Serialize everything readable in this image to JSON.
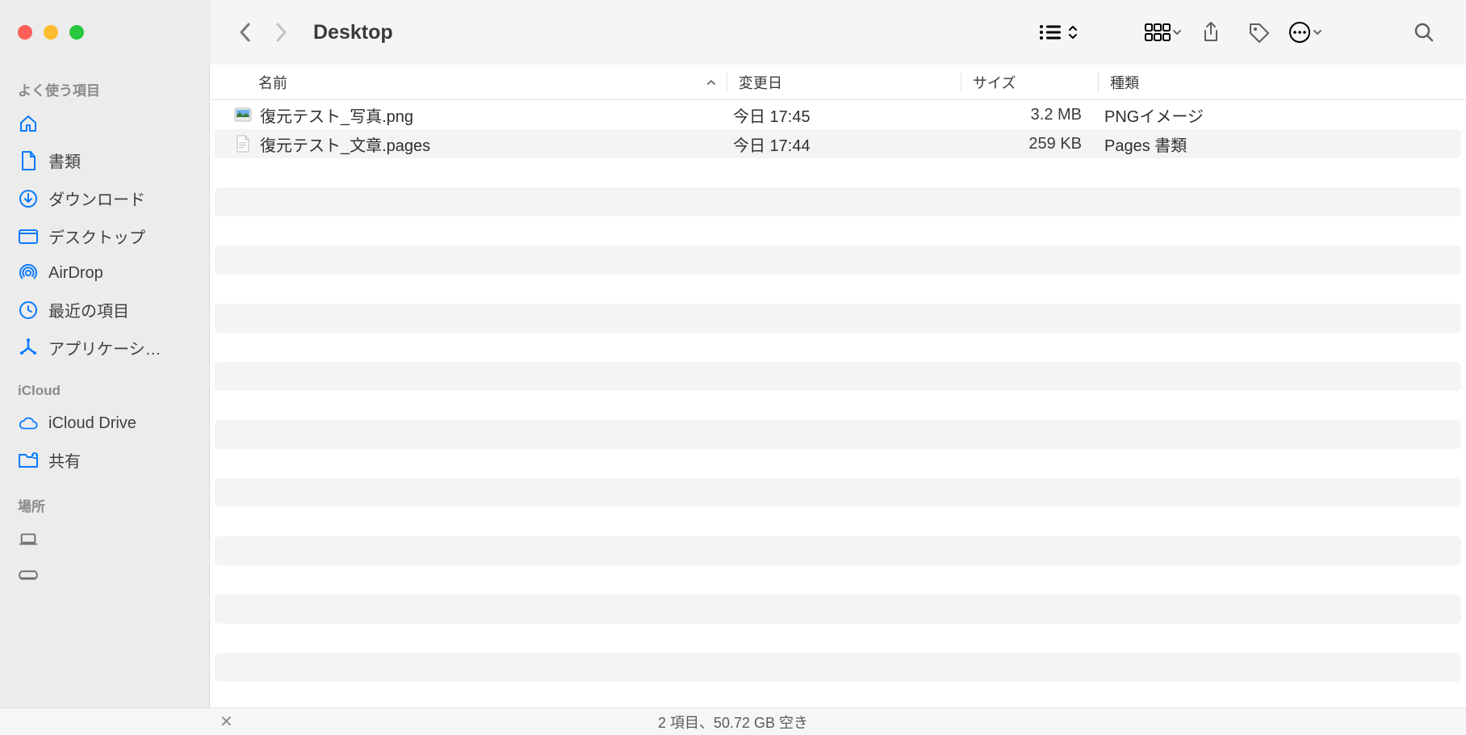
{
  "window": {
    "title": "Desktop"
  },
  "sidebar": {
    "sections": [
      {
        "title": "よく使う項目",
        "items": [
          {
            "icon": "house",
            "label": ""
          },
          {
            "icon": "doc",
            "label": "書類"
          },
          {
            "icon": "down",
            "label": "ダウンロード"
          },
          {
            "icon": "desk",
            "label": "デスクトップ"
          },
          {
            "icon": "airdrop",
            "label": "AirDrop"
          },
          {
            "icon": "clock",
            "label": "最近の項目"
          },
          {
            "icon": "apps",
            "label": "アプリケーシ…"
          }
        ]
      },
      {
        "title": "iCloud",
        "items": [
          {
            "icon": "cloud",
            "label": "iCloud Drive"
          },
          {
            "icon": "share",
            "label": "共有"
          }
        ]
      },
      {
        "title": "場所",
        "items": [
          {
            "icon": "laptop",
            "label": ""
          },
          {
            "icon": "disk",
            "label": ""
          }
        ]
      }
    ]
  },
  "columns": {
    "name": "名前",
    "modified": "変更日",
    "size": "サイズ",
    "kind": "種類"
  },
  "files": [
    {
      "icon": "img",
      "name": "復元テスト_写真.png",
      "modified": "今日 17:45",
      "size": "3.2 MB",
      "kind": "PNGイメージ"
    },
    {
      "icon": "page",
      "name": "復元テスト_文章.pages",
      "modified": "今日 17:44",
      "size": "259 KB",
      "kind": "Pages 書類"
    }
  ],
  "status": {
    "text": "2 項目、50.72 GB 空き"
  }
}
